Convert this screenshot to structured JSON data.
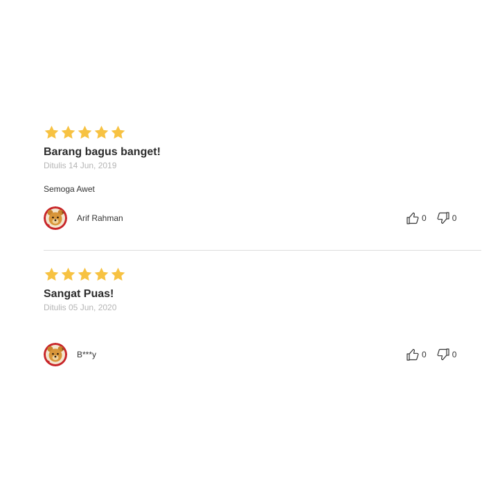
{
  "colors": {
    "star": "#f7c242",
    "title": "#2b2b2b",
    "date": "#b5b5b5",
    "divider": "#dcdcdc"
  },
  "reviews": [
    {
      "rating": 5,
      "title": "Barang bagus banget!",
      "date": "Ditulis 14 Jun, 2019",
      "body": "Semoga Awet",
      "author": "Arif Rahman",
      "avatar_icon": "bear-avatar-icon",
      "likes": "0",
      "dislikes": "0"
    },
    {
      "rating": 5,
      "title": "Sangat Puas!",
      "date": "Ditulis 05 Jun, 2020",
      "body": "",
      "author": "B***y",
      "avatar_icon": "bear-avatar-icon",
      "likes": "0",
      "dislikes": "0"
    }
  ]
}
